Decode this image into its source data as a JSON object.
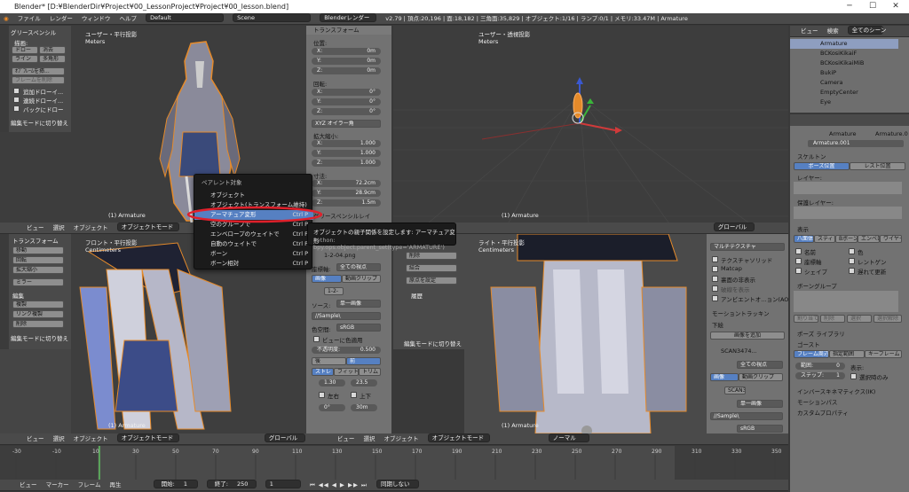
{
  "window": {
    "title": "Blender* [D:¥BlenderDir¥Project¥00_LessonProject¥Project¥00_lesson.blend]",
    "min": "─",
    "max": "☐",
    "close": "✕"
  },
  "topbar": {
    "menus": [
      "ファイル",
      "レンダー",
      "ウィンドウ",
      "ヘルプ"
    ],
    "layout": "Default",
    "scene": "Scene",
    "engine": "Blenderレンダー",
    "stats": "v2.79 | 頂点:20,196 | 面:18,182 | 三角面:35,829 | オブジェクト:1/16 | ランプ:0/1 | メモリ:33.47M | Armature"
  },
  "tl_view": {
    "label": "ユーザー・平行投影",
    "unit": "Meters",
    "obj": "(1) Armature"
  },
  "grease": {
    "title": "グリースペンシル",
    "draw_label": "描画:",
    "draw": "ドロー",
    "erase": "消去",
    "line": "ライン",
    "poly": "多角形",
    "frame": "ｵﾌﾞﾌﾚｰﾑを挿...",
    "frame2": "フレームを削除",
    "add_draw": "追加ドローイ...",
    "cont_draw": "連続ドローイ...",
    "back_draw": "バックにドロー",
    "mode_switch": "編集モードに切り替え"
  },
  "transform": {
    "title": "トランスフォーム",
    "loc": "位置:",
    "lx": "X:",
    "lxv": "0m",
    "ly": "Y:",
    "lyv": "0m",
    "lz": "Z:",
    "lzv": "0m",
    "rot": "回転:",
    "rxv": "0°",
    "ryv": "0°",
    "rzv": "0°",
    "rmode": "XYZ オイラー角",
    "scale": "拡大縮小:",
    "sx": "1.000",
    "sy": "1.000",
    "sz": "1.000",
    "dim": "寸法:",
    "dx": "72.2cm",
    "dy": "28.9cm",
    "dz": "1.5m",
    "grease_layer": "グリースペンシルレイ"
  },
  "tr_view": {
    "label": "ユーザー・透視投影",
    "unit": "Meters",
    "obj": "(1) Armature"
  },
  "mid_header": {
    "menus": [
      "ビュー",
      "選択",
      "オブジェクト"
    ],
    "mode": "オブジェクトモード",
    "orient": "グローバル"
  },
  "parent_menu": {
    "title": "ペアレント対象",
    "items": [
      {
        "label": "オブジェクト",
        "sc": ""
      },
      {
        "label": "オブジェクト(トランスフォーム維持)",
        "sc": ""
      },
      {
        "label": "アーマチュア変形",
        "sc": "Ctrl P"
      },
      {
        "label": "空のグループで",
        "sc": "Ctrl P"
      },
      {
        "label": "エンベロープのウェイトで",
        "sc": "Ctrl P"
      },
      {
        "label": "自動のウェイトで",
        "sc": "Ctrl P"
      },
      {
        "label": "ボーン",
        "sc": "Ctrl P"
      },
      {
        "label": "ボーン相対",
        "sc": "Ctrl P"
      }
    ]
  },
  "tooltip": {
    "line1": "オブジェクトの親子関係を設定します: アーマチュア変形",
    "line2": "Python: bpy.ops.object.parent_set(type='ARMATURE')"
  },
  "bl_tools": {
    "title": "トランスフォーム",
    "move": "移動",
    "rotate": "回転",
    "scale": "拡大縮小",
    "mirror": "ミラー",
    "edit": "編集",
    "dup": "複製",
    "link_dup": "リンク複製",
    "delete": "削除",
    "mode": "編集モードに切り替え",
    "view_label": "フロント・平行投影",
    "unit": "Centimeters",
    "obj": "(1) Armature"
  },
  "bg_image": {
    "file": "1-2-04.png",
    "axis": "全ての視点",
    "axis_lbl": "座標軸:",
    "image": "画像",
    "movie": "動画クリップ",
    "num": "1-2-",
    "src_lbl": "ソース:",
    "src": "単一画像",
    "path": "//Sample\\",
    "color_lbl": "色空間:",
    "color": "sRGB",
    "view_as": "ビューに色適用",
    "opacity_lbl": "不透明度:",
    "opacity": "0.500",
    "back": "後",
    "front": "前",
    "stretch": "ストレ",
    "fit": "フィット",
    "crop": "トリム",
    "v1": "1.30",
    "v2": "23.5",
    "flipx": "左右",
    "flipy": "上下",
    "rot": "0°",
    "off": "30m"
  },
  "del_menu": {
    "del": "削除",
    "join": "結合",
    "origin": "原点を設定",
    "history": "履歴",
    "mode": "編集モードに切り替え"
  },
  "br_view": {
    "label": "ライト・平行投影",
    "unit": "Centimeters",
    "obj": "(1) Armature"
  },
  "multitex": {
    "title": "マルチテクスチャ",
    "tex": "テクスチャソリッド",
    "matcap": "Matcap",
    "back_cull": "裏面の非表示",
    "clip": "破線を表示",
    "ao": "アンビエントオ...ョン(AO)",
    "motion": "モーショントラッキン",
    "bg": "下絵",
    "add_img": "画像を追加",
    "scan": "SCAN3474...",
    "axis": "全ての視点",
    "image": "画像",
    "movie": "動画クリップ",
    "scan2": "SCAN3",
    "src": "単一画像",
    "path": "//Sample\\",
    "colorsp": "sRGB"
  },
  "bottom_headers": {
    "left": [
      "ビュー",
      "選択",
      "オブジェクト"
    ],
    "mode": "オブジェクトモード",
    "orient": "グローバル",
    "right_orient": "ノーマル"
  },
  "outliner": {
    "menus": [
      "ビュー",
      "検索"
    ],
    "scene": "全てのシーン",
    "items": [
      "Armature",
      "BCKosiKikaiF",
      "BCKosiKikaiMiB",
      "BukiP",
      "Camera",
      "EmptyCenter",
      "Eye"
    ]
  },
  "props": {
    "obj": "Armature",
    "data": "Armature.0",
    "name": "Armature.001",
    "skeleton": "スケルトン",
    "pose": "ポーズ位置",
    "rest": "レスト位置",
    "layer": "レイヤー:",
    "protect": "保護レイヤー:",
    "display": "表示",
    "oct": "八面体",
    "stick": "スティッ",
    "bbone": "Bボーン",
    "env": "エンベロ",
    "wire": "ワイヤー",
    "name_cb": "名前",
    "color_cb": "色",
    "axis_cb": "座標軸",
    "xray_cb": "レントゲン",
    "shape_cb": "シェイプ",
    "delay_cb": "遅れて更新",
    "bone_group": "ボーングループ",
    "assign": "割り当て",
    "remove": "削除",
    "select": "選択",
    "deselect": "選択解除",
    "pose_lib": "ポーズ ライブラリ",
    "ghost": "ゴースト",
    "around": "フレーム周辺",
    "range": "指定範囲",
    "keyframe": "キーフレーム",
    "range_lbl": "範囲:",
    "range_v": "0",
    "step_lbl": "ステップ:",
    "step_v": "1",
    "show": "表示:",
    "sel_only": "選択時のみ",
    "ik": "インバースキネマティクス(IK)",
    "motion_path": "モーションパス",
    "custom_prop": "カスタムプロパティ"
  },
  "timeline": {
    "ticks": [
      "-30",
      "-10",
      "10",
      "30",
      "50",
      "70",
      "90",
      "110",
      "130",
      "150",
      "170",
      "190",
      "210",
      "230",
      "250",
      "270",
      "290",
      "310",
      "330",
      "350"
    ],
    "menus": [
      "ビュー",
      "マーカー",
      "フレーム",
      "再生"
    ],
    "start_lbl": "開始:",
    "start": "1",
    "end_lbl": "終了:",
    "end": "250",
    "cur": "1",
    "sync": "同期しない"
  },
  "colors": {
    "accent": "#5680c2",
    "highlight_ring": "#e0202b",
    "armature_orange": "#e58a2a"
  }
}
